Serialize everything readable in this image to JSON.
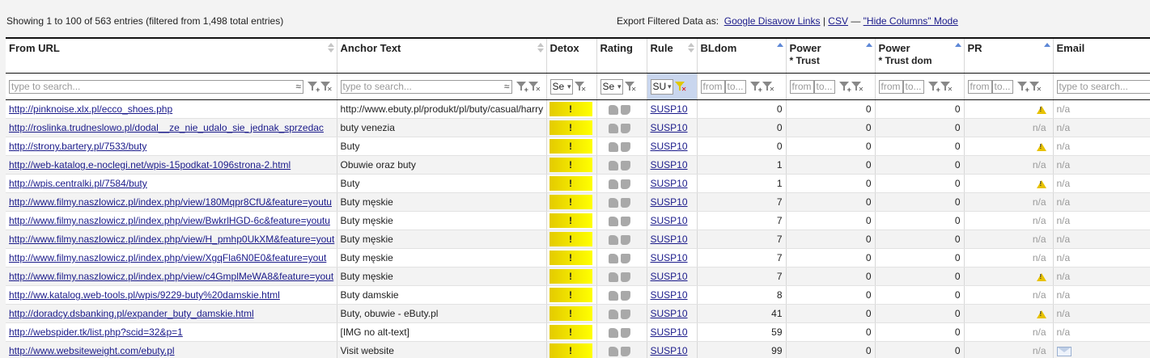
{
  "summary": "Showing 1 to 100 of 563 entries (filtered from 1,498 total entries)",
  "export": {
    "label": "Export Filtered Data as:",
    "google": "Google Disavow Links",
    "sep1": "|",
    "csv": "CSV",
    "sep2": "—",
    "hide": "\"Hide Columns\" Mode"
  },
  "columns": {
    "from_url": "From URL",
    "anchor": "Anchor Text",
    "detox": "Detox",
    "rating": "Rating",
    "rule": "Rule",
    "bldom": "BLdom",
    "power_trust": "Power",
    "power_trust_sub": "* Trust",
    "power_trust_dom": "Power",
    "power_trust_dom_sub": "* Trust dom",
    "pr": "PR",
    "email": "Email"
  },
  "filters": {
    "text_placeholder": "type to search...",
    "from_placeholder": "from",
    "to_placeholder": "to...",
    "detox_select": "Se",
    "rating_select": "Se",
    "rule_select": "SU"
  },
  "colors": {
    "link": "#1a1a8a",
    "detox_start": "#e4cb00",
    "detox_end": "#ffff00",
    "rule_active": "#c9d6ee"
  },
  "rows": [
    {
      "url": "http://pinknoise.xlx.pl/ecco_shoes.php",
      "anchor": "http://www.ebuty.pl/produkt/pl/buty/casual/harry",
      "detox": "!",
      "rule": "SUSP10",
      "bldom": "0",
      "pt": "0",
      "ptd": "0",
      "pr": "warning-icon",
      "email": "n/a"
    },
    {
      "url": "http://roslinka.trudneslowo.pl/dodal__ze_nie_udalo_sie_jednak_sprzedac",
      "anchor": "buty venezia",
      "detox": "!",
      "rule": "SUSP10",
      "bldom": "0",
      "pt": "0",
      "ptd": "0",
      "pr": "n/a",
      "email": "n/a"
    },
    {
      "url": "http://strony.bartery.pl/7533/buty",
      "anchor": "Buty",
      "detox": "!",
      "rule": "SUSP10",
      "bldom": "0",
      "pt": "0",
      "ptd": "0",
      "pr": "warning-icon",
      "email": "n/a"
    },
    {
      "url": "http://web-katalog.e-noclegi.net/wpis-15podkat-1096strona-2.html",
      "anchor": "Obuwie oraz buty",
      "detox": "!",
      "rule": "SUSP10",
      "bldom": "1",
      "pt": "0",
      "ptd": "0",
      "pr": "n/a",
      "email": "n/a"
    },
    {
      "url": "http://wpis.centralki.pl/7584/buty",
      "anchor": "Buty",
      "detox": "!",
      "rule": "SUSP10",
      "bldom": "1",
      "pt": "0",
      "ptd": "0",
      "pr": "warning-icon",
      "email": "n/a"
    },
    {
      "url": "http://www.filmy.naszlowicz.pl/index.php/view/180Mqpr8CfU&feature=youtu",
      "anchor": "Buty męskie",
      "detox": "!",
      "rule": "SUSP10",
      "bldom": "7",
      "pt": "0",
      "ptd": "0",
      "pr": "n/a",
      "email": "n/a"
    },
    {
      "url": "http://www.filmy.naszlowicz.pl/index.php/view/BwkrlHGD-6c&feature=youtu",
      "anchor": "Buty męskie",
      "detox": "!",
      "rule": "SUSP10",
      "bldom": "7",
      "pt": "0",
      "ptd": "0",
      "pr": "n/a",
      "email": "n/a"
    },
    {
      "url": "http://www.filmy.naszlowicz.pl/index.php/view/H_pmhp0UkXM&feature=yout",
      "anchor": "Buty męskie",
      "detox": "!",
      "rule": "SUSP10",
      "bldom": "7",
      "pt": "0",
      "ptd": "0",
      "pr": "n/a",
      "email": "n/a"
    },
    {
      "url": "http://www.filmy.naszlowicz.pl/index.php/view/XgqFla6N0E0&feature=yout",
      "anchor": "Buty męskie",
      "detox": "!",
      "rule": "SUSP10",
      "bldom": "7",
      "pt": "0",
      "ptd": "0",
      "pr": "n/a",
      "email": "n/a"
    },
    {
      "url": "http://www.filmy.naszlowicz.pl/index.php/view/c4GmplMeWA8&feature=yout",
      "anchor": "Buty męskie",
      "detox": "!",
      "rule": "SUSP10",
      "bldom": "7",
      "pt": "0",
      "ptd": "0",
      "pr": "warning-icon",
      "email": "n/a"
    },
    {
      "url": "http://ww.katalog.web-tools.pl/wpis/9229-buty%20damskie.html",
      "anchor": "Buty damskie",
      "detox": "!",
      "rule": "SUSP10",
      "bldom": "8",
      "pt": "0",
      "ptd": "0",
      "pr": "n/a",
      "email": "n/a"
    },
    {
      "url": "http://doradcy.dsbanking.pl/expander_buty_damskie.html",
      "anchor": "Buty, obuwie - eButy.pl",
      "detox": "!",
      "rule": "SUSP10",
      "bldom": "41",
      "pt": "0",
      "ptd": "0",
      "pr": "warning-icon",
      "email": "n/a"
    },
    {
      "url": "http://webspider.tk/list.php?scid=32&p=1",
      "anchor": "[IMG no alt-text]",
      "detox": "!",
      "rule": "SUSP10",
      "bldom": "59",
      "pt": "0",
      "ptd": "0",
      "pr": "n/a",
      "email": "n/a"
    },
    {
      "url": "http://www.websiteweight.com/ebuty.pl",
      "anchor": "Visit website",
      "detox": "!",
      "rule": "SUSP10",
      "bldom": "99",
      "pt": "0",
      "ptd": "0",
      "pr": "n/a",
      "email": "envelope-icon"
    }
  ]
}
